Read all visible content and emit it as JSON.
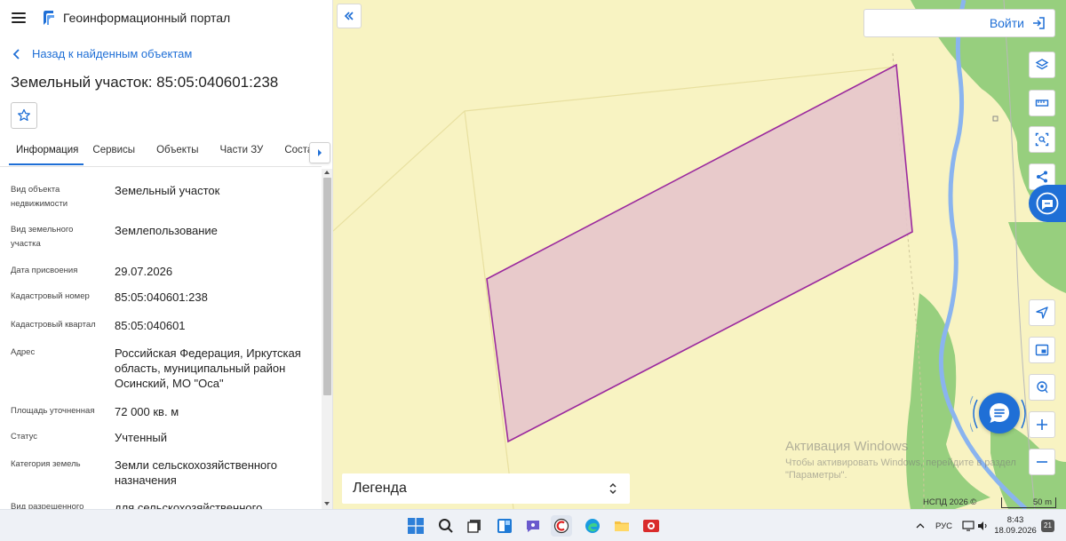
{
  "app": {
    "title": "Геоинформационный портал",
    "back_link": "Назад к найденным объектам",
    "object_title": "Земельный участок: 85:05:040601:238"
  },
  "tabs": [
    {
      "label": "Информация",
      "active": true
    },
    {
      "label": "Сервисы",
      "active": false
    },
    {
      "label": "Объекты",
      "active": false
    },
    {
      "label": "Части ЗУ",
      "active": false
    },
    {
      "label": "Состав",
      "active": false
    }
  ],
  "properties": [
    {
      "label": "Вид объекта недвижимости",
      "value": "Земельный участок"
    },
    {
      "label": "Вид земельного участка",
      "value": "Землепользование"
    },
    {
      "label": "Дата присвоения",
      "value": "29.07.2026"
    },
    {
      "label": "Кадастровый номер",
      "value": "85:05:040601:238"
    },
    {
      "label": "Кадастровый квартал",
      "value": "85:05:040601"
    },
    {
      "label": "Адрес",
      "value": "Российская Федерация, Иркутская область, муниципальный район Осинский, МО \"Оса\""
    },
    {
      "label": "Площадь уточненная",
      "value": "72 000 кв. м"
    },
    {
      "label": "Статус",
      "value": "Учтенный"
    },
    {
      "label": "Категория земель",
      "value": "Земли сельскохозяйственного назначения"
    },
    {
      "label": "Вид разрешенного",
      "value": "для сельскохозяйственного"
    }
  ],
  "map": {
    "login_label": "Войти",
    "legend_label": "Легенда",
    "watermark_title": "Активация Windows",
    "watermark_text_1": "Чтобы активировать Windows, перейдите в раздел",
    "watermark_text_2": "\"Параметры\".",
    "copyright": "НСПД 2026 ©",
    "scale_label": "50 m",
    "colors": {
      "background": "#f8f3c2",
      "parcel_fill": "#e6c5cc",
      "parcel_stroke": "#9b2a9e",
      "forest": "#97cf7e",
      "river": "#8ab4ef",
      "accent": "#1f6fd6"
    },
    "tools": [
      "layers-icon",
      "ruler-icon",
      "select-area-icon",
      "share-icon",
      "navigate-icon",
      "picture-in-picture-icon",
      "location-search-icon",
      "zoom-in-icon",
      "zoom-out-icon"
    ]
  },
  "taskbar": {
    "tray_lang": "РУС",
    "time": "8:43",
    "date": "18.09.2026",
    "notifications": "21"
  }
}
